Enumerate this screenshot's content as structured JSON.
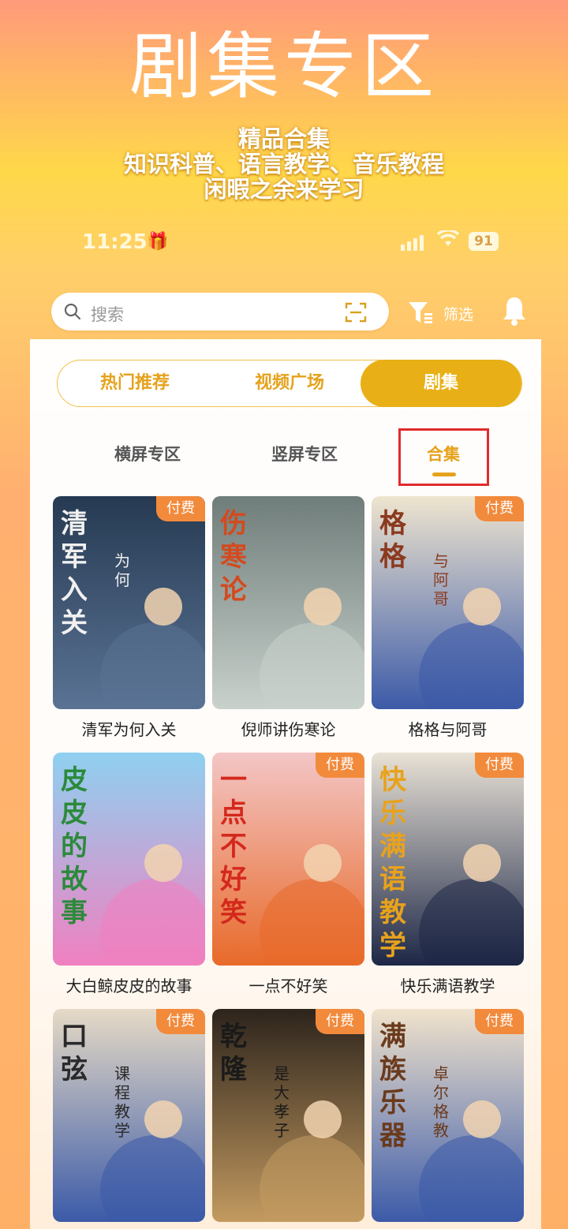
{
  "promo": {
    "title": "剧集专区",
    "line1": "精品合集",
    "line2": "知识科普、语言教学、音乐教程",
    "line3": "闲暇之余来学习"
  },
  "status": {
    "time": "11:25",
    "battery": "91"
  },
  "search": {
    "placeholder": "搜索",
    "filter_label": "筛选"
  },
  "main_tabs": [
    "热门推荐",
    "视频广场",
    "剧集"
  ],
  "sub_tabs": [
    "横屏专区",
    "竖屏专区",
    "合集"
  ],
  "cards": [
    {
      "title": "清军为何入关",
      "badge": "付费",
      "cover_text": "清军入关",
      "cover_small": "为何"
    },
    {
      "title": "倪师讲伤寒论",
      "badge": "",
      "cover_text": "伤寒论",
      "cover_small": ""
    },
    {
      "title": "格格与阿哥",
      "badge": "付费",
      "cover_text": "格格",
      "cover_small": "与阿哥"
    },
    {
      "title": "大白鲸皮皮的故事",
      "badge": "",
      "cover_text": "皮皮的故事",
      "cover_small": ""
    },
    {
      "title": "一点不好笑",
      "badge": "付费",
      "cover_text": "一点不好笑",
      "cover_small": ""
    },
    {
      "title": "快乐满语教学",
      "badge": "付费",
      "cover_text": "快乐满语教学",
      "cover_small": ""
    },
    {
      "title": "",
      "badge": "付费",
      "cover_text": "口弦",
      "cover_small": "课程教学"
    },
    {
      "title": "",
      "badge": "付费",
      "cover_text": "乾隆",
      "cover_small": "是大孝子"
    },
    {
      "title": "",
      "badge": "付费",
      "cover_text": "满族乐器",
      "cover_small": "卓尔格教"
    }
  ],
  "colors": {
    "accent": "#e8b016",
    "badge": "#f28a3c",
    "highlight": "#e02b2b"
  }
}
